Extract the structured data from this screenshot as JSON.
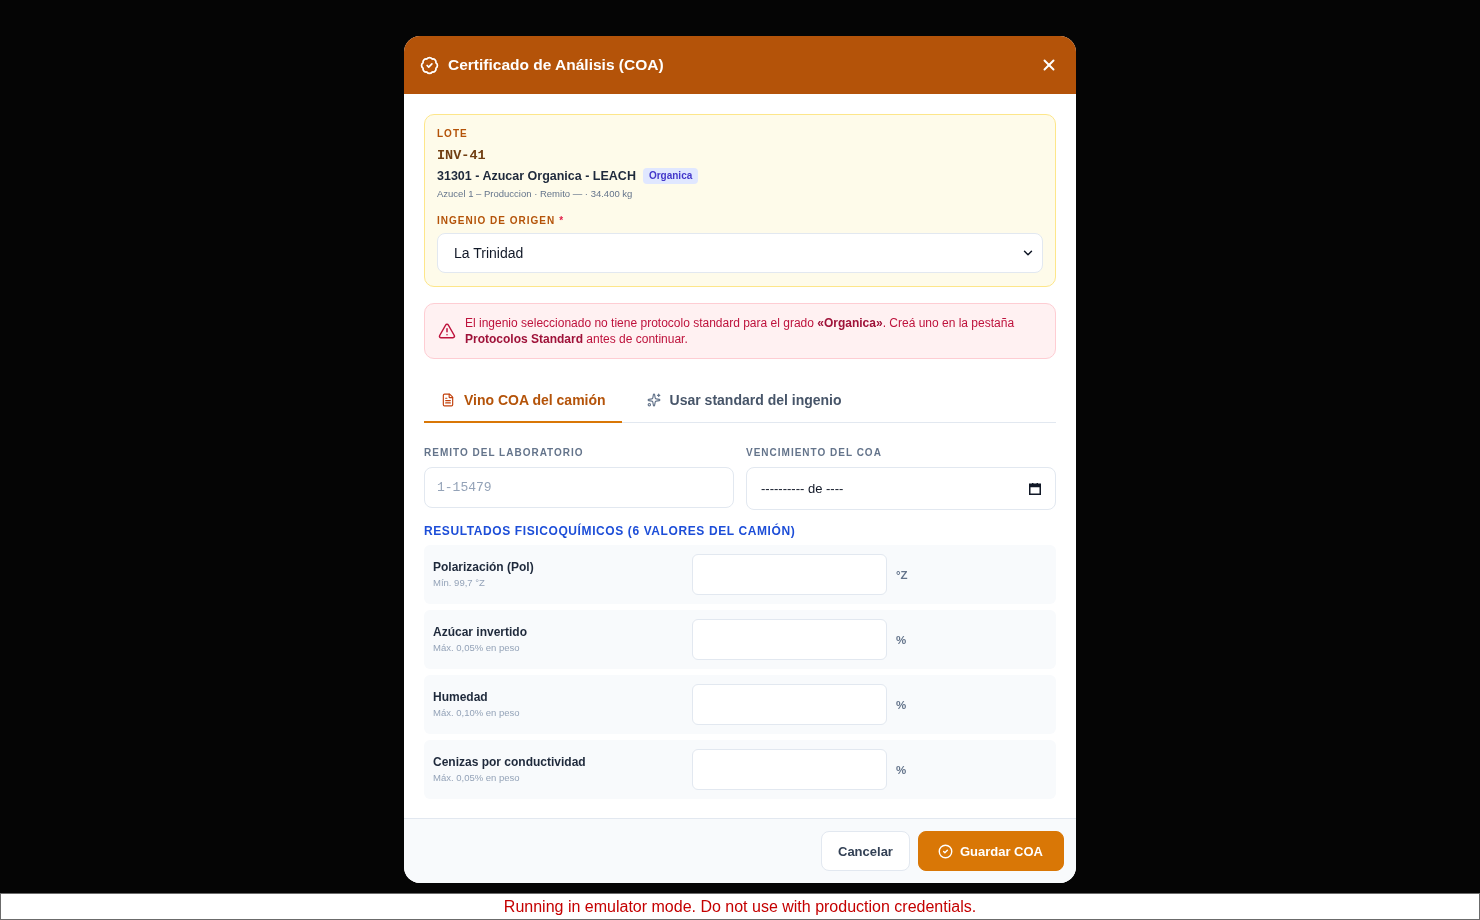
{
  "dialog": {
    "title": "Certificado de Análisis (COA)"
  },
  "lote": {
    "label": "LOTE",
    "code": "INV-41",
    "product": "31301 - Azucar Organica - LEACH",
    "grade_badge": "Organica",
    "details": "Azucel 1 – Produccion · Remito — · 34.400 kg"
  },
  "ingenio_field": {
    "label": "INGENIO DE ORIGEN",
    "required_mark": "*",
    "value": "La Trinidad"
  },
  "alert": {
    "text": "El ingenio seleccionado no tiene protocolo standard para el grado **«Organica»**. Creá uno en la pestaña **Protocolos Standard** antes de continuar."
  },
  "tabs": [
    {
      "label": "Vino COA del camión",
      "selected": true
    },
    {
      "label": "Usar standard del ingenio",
      "selected": false
    }
  ],
  "remito_field": {
    "label": "REMITO DEL LABORATORIO",
    "placeholder": "1-15479"
  },
  "vencimiento_field": {
    "label": "VENCIMIENTO DEL COA",
    "value": "---------- de ----"
  },
  "results": {
    "heading": "RESULTADOS FISICOQUÍMICOS (6 VALORES DEL CAMIÓN)",
    "rows": [
      {
        "label": "Polarización (Pol)",
        "hint": "Mín. 99,7 °Z",
        "unit": "°Z"
      },
      {
        "label": "Azúcar invertido",
        "hint": "Máx. 0,05% en peso",
        "unit": "%"
      },
      {
        "label": "Humedad",
        "hint": "Máx. 0,10% en peso",
        "unit": "%"
      },
      {
        "label": "Cenizas por conductividad",
        "hint": "Máx. 0,05% en peso",
        "unit": "%"
      }
    ]
  },
  "footer": {
    "buttons": [
      {
        "label": "Cancelar",
        "kind": "secondary"
      },
      {
        "label": "Guardar COA",
        "kind": "primary"
      }
    ]
  },
  "emulator_banner": {
    "text": "Running in emulator mode. Do not use with production credentials."
  }
}
